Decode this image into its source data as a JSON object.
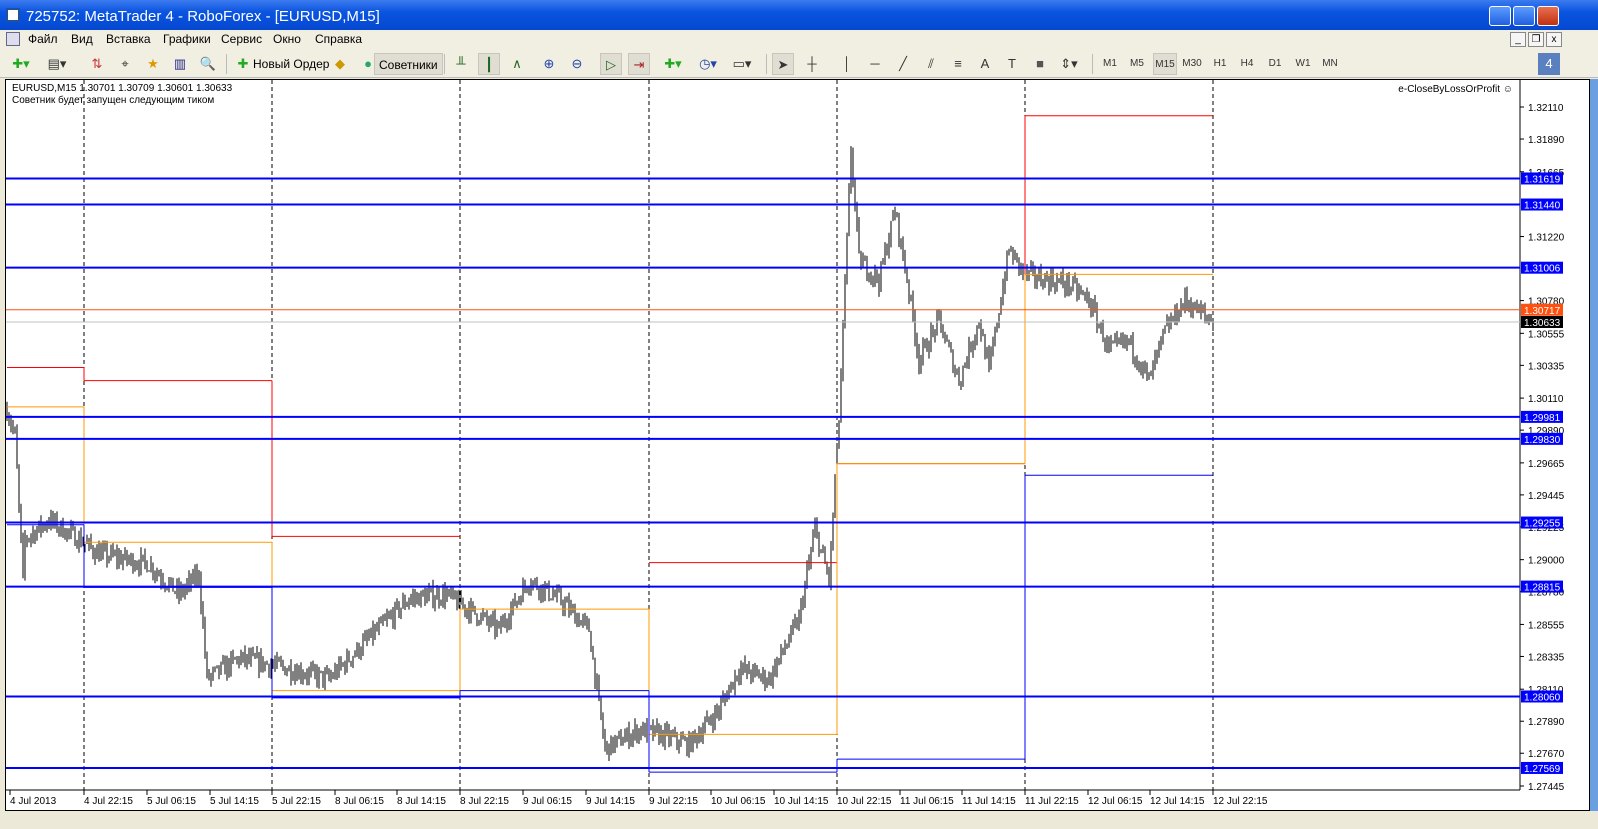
{
  "window": {
    "title": "725752: MetaTrader 4 - RoboForex - [EURUSD,M15]"
  },
  "menu": [
    "Файл",
    "Вид",
    "Вставка",
    "Графики",
    "Сервис",
    "Окно",
    "Справка"
  ],
  "toolbar": {
    "new_order": "Новый Ордер",
    "experts": "Советники",
    "timeframes": [
      "M1",
      "M5",
      "M15",
      "M30",
      "H1",
      "H4",
      "D1",
      "W1",
      "MN"
    ],
    "active_timeframe": "M15",
    "badge": "4"
  },
  "chart": {
    "symbol_info": "EURUSD,M15  1.30701 1.30709 1.30601 1.30633",
    "status": "Советник будет запущен следующим тиком",
    "expert_name": "e-CloseByLossOrProfit",
    "price_ticks": [
      "1.32110",
      "1.31890",
      "1.31665",
      "1.31220",
      "1.30780",
      "1.30555",
      "1.30335",
      "1.30110",
      "1.29890",
      "1.29665",
      "1.29445",
      "1.29225",
      "1.29000",
      "1.28780",
      "1.28555",
      "1.28335",
      "1.28110",
      "1.27890",
      "1.27670",
      "1.27445"
    ],
    "time_ticks": [
      "4 Jul 2013",
      "4 Jul 22:15",
      "5 Jul 06:15",
      "5 Jul 14:15",
      "5 Jul 22:15",
      "8 Jul 06:15",
      "8 Jul 14:15",
      "8 Jul 22:15",
      "9 Jul 06:15",
      "9 Jul 14:15",
      "9 Jul 22:15",
      "10 Jul 06:15",
      "10 Jul 14:15",
      "10 Jul 22:15",
      "11 Jul 06:15",
      "11 Jul 14:15",
      "11 Jul 22:15",
      "12 Jul 06:15",
      "12 Jul 14:15",
      "12 Jul 22:15"
    ],
    "levels": [
      "1.31619",
      "1.31440",
      "1.31006",
      "1.29981",
      "1.29830",
      "1.29255",
      "1.28815",
      "1.28060",
      "1.27569"
    ],
    "level_color": "#0000ff",
    "orange_line": "1.30717",
    "bid": "1.30633",
    "day_high": [
      1.3032,
      1.3023,
      1.2916,
      null,
      1.2898,
      1.2966,
      1.3205
    ],
    "day_mid": [
      1.3005,
      1.2912,
      1.281,
      1.2866,
      1.278,
      1.2966,
      1.3096
    ],
    "day_low": [
      1.2924,
      1.2881,
      1.2805,
      1.281,
      1.2754,
      1.2763,
      1.2958
    ],
    "price_path": [
      [
        0,
        1.3003
      ],
      [
        4,
        1.2985
      ],
      [
        8,
        1.2886
      ],
      [
        9,
        1.2914
      ],
      [
        21,
        1.2927
      ],
      [
        36,
        1.2914
      ],
      [
        46,
        1.2904
      ],
      [
        71,
        1.2897
      ],
      [
        86,
        1.2876
      ],
      [
        96,
        1.289
      ],
      [
        100,
        1.2818
      ],
      [
        116,
        1.2832
      ],
      [
        131,
        1.2828
      ],
      [
        141,
        1.2825
      ],
      [
        161,
        1.2818
      ],
      [
        176,
        1.2839
      ],
      [
        201,
        1.2873
      ],
      [
        219,
        1.2876
      ],
      [
        231,
        1.2866
      ],
      [
        246,
        1.2852
      ],
      [
        261,
        1.2886
      ],
      [
        276,
        1.2873
      ],
      [
        291,
        1.2852
      ],
      [
        299,
        1.277
      ],
      [
        316,
        1.2783
      ],
      [
        326,
        1.278
      ],
      [
        341,
        1.2773
      ],
      [
        356,
        1.2797
      ],
      [
        366,
        1.2825
      ],
      [
        381,
        1.2818
      ],
      [
        396,
        1.2859
      ],
      [
        404,
        1.2921
      ],
      [
        411,
        1.2886
      ],
      [
        416,
        1.2996
      ],
      [
        422,
        1.3181
      ],
      [
        426,
        1.3106
      ],
      [
        436,
        1.3092
      ],
      [
        444,
        1.314
      ],
      [
        451,
        1.3085
      ],
      [
        456,
        1.3037
      ],
      [
        466,
        1.3064
      ],
      [
        476,
        1.3023
      ],
      [
        486,
        1.3064
      ],
      [
        491,
        1.303
      ],
      [
        501,
        1.3113
      ],
      [
        509,
        1.3096
      ],
      [
        521,
        1.3092
      ],
      [
        531,
        1.3089
      ],
      [
        541,
        1.3078
      ],
      [
        551,
        1.3044
      ],
      [
        561,
        1.305
      ],
      [
        571,
        1.3023
      ],
      [
        579,
        1.3057
      ],
      [
        589,
        1.3078
      ],
      [
        603,
        1.3063
      ]
    ]
  }
}
